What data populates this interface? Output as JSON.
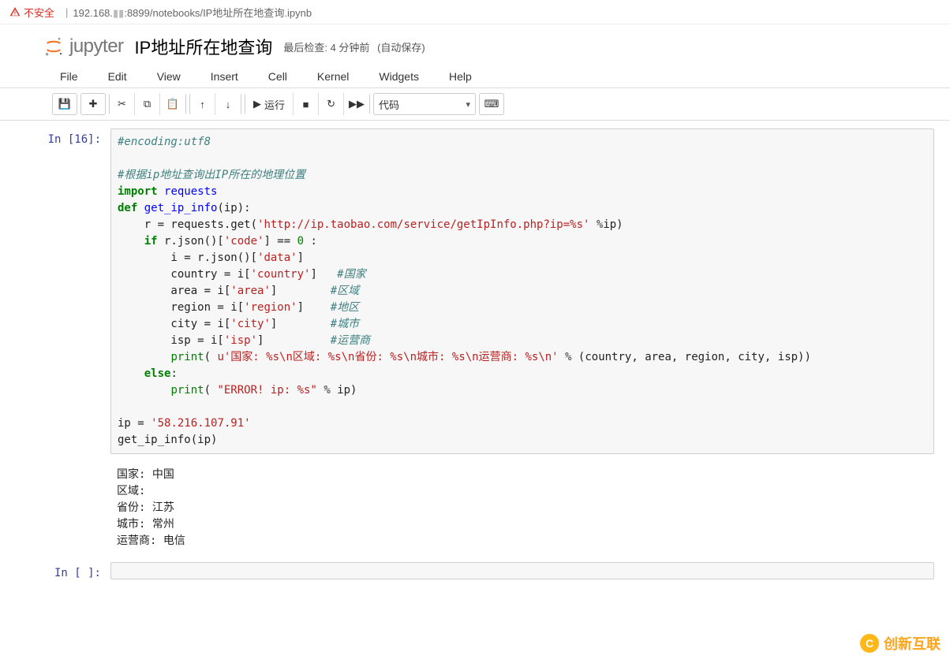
{
  "address_bar": {
    "security_label": "不安全",
    "url_prefix": "192.168.",
    "url_mid_masked": "▮▮",
    "url_suffix": ":8899/notebooks/IP地址所在地查询.ipynb"
  },
  "header": {
    "logo_text": "jupyter",
    "notebook_name": "IP地址所在地查询",
    "last_check_label": "最后检查:",
    "last_check_value": "4 分钟前",
    "autosave_label": "(自动保存)"
  },
  "menus": {
    "file": "File",
    "edit": "Edit",
    "view": "View",
    "insert": "Insert",
    "cell": "Cell",
    "kernel": "Kernel",
    "widgets": "Widgets",
    "help": "Help"
  },
  "toolbar": {
    "run_label": "运行",
    "cell_type": "代码"
  },
  "cells": [
    {
      "prompt": "In  [16]:",
      "code_tokens": [
        [
          [
            "#encoding:utf8",
            "c"
          ]
        ],
        [],
        [
          [
            "#根据ip地址查询出IP所在的地理位置",
            "c"
          ]
        ],
        [
          [
            "import",
            "kn"
          ],
          [
            " ",
            null
          ],
          [
            "requests",
            "nm"
          ]
        ],
        [
          [
            "def",
            "kn"
          ],
          [
            " ",
            null
          ],
          [
            "get_ip_info",
            "fn"
          ],
          [
            "(ip):",
            null
          ]
        ],
        [
          [
            "    r = requests.get(",
            null
          ],
          [
            "'http://ip.taobao.com/service/getIpInfo.php?ip=%s'",
            "st"
          ],
          [
            " ",
            null
          ],
          [
            "%",
            "op"
          ],
          [
            "ip)",
            null
          ]
        ],
        [
          [
            "    ",
            null
          ],
          [
            "if",
            "kw"
          ],
          [
            " r.json()[",
            null
          ],
          [
            "'code'",
            "st"
          ],
          [
            "] == ",
            null
          ],
          [
            "0",
            "nb"
          ],
          [
            " :",
            null
          ]
        ],
        [
          [
            "        i = r.json()[",
            null
          ],
          [
            "'data'",
            "st"
          ],
          [
            "]",
            null
          ]
        ],
        [
          [
            "        country = i[",
            null
          ],
          [
            "'country'",
            "st"
          ],
          [
            "]   ",
            null
          ],
          [
            "#国家",
            "c"
          ]
        ],
        [
          [
            "        area = i[",
            null
          ],
          [
            "'area'",
            "st"
          ],
          [
            "]        ",
            null
          ],
          [
            "#区域",
            "c"
          ]
        ],
        [
          [
            "        region = i[",
            null
          ],
          [
            "'region'",
            "st"
          ],
          [
            "]    ",
            null
          ],
          [
            "#地区",
            "c"
          ]
        ],
        [
          [
            "        city = i[",
            null
          ],
          [
            "'city'",
            "st"
          ],
          [
            "]        ",
            null
          ],
          [
            "#城市",
            "c"
          ]
        ],
        [
          [
            "        isp = i[",
            null
          ],
          [
            "'isp'",
            "st"
          ],
          [
            "]          ",
            null
          ],
          [
            "#运营商",
            "c"
          ]
        ],
        [
          [
            "        ",
            null
          ],
          [
            "print",
            "pr"
          ],
          [
            "( ",
            null
          ],
          [
            "u'国家: %s\\n区域: %s\\n省份: %s\\n城市: %s\\n运营商: %s\\n'",
            "st"
          ],
          [
            " ",
            null
          ],
          [
            "%",
            "op"
          ],
          [
            " (country, area, region, city, isp))",
            null
          ]
        ],
        [
          [
            "    ",
            null
          ],
          [
            "else",
            "kw"
          ],
          [
            ":",
            null
          ]
        ],
        [
          [
            "        ",
            null
          ],
          [
            "print",
            "pr"
          ],
          [
            "( ",
            null
          ],
          [
            "\"ERROR! ip: %s\"",
            "st"
          ],
          [
            " ",
            null
          ],
          [
            "%",
            "op"
          ],
          [
            " ip)",
            null
          ]
        ],
        [],
        [
          [
            "ip = ",
            null
          ],
          [
            "'58.216.107.91'",
            "st"
          ]
        ],
        [
          [
            "get_ip_info(ip)",
            null
          ]
        ]
      ],
      "output": "国家: 中国\n区域: \n省份: 江苏\n城市: 常州\n运营商: 电信"
    },
    {
      "prompt": "In  [ ]:",
      "code_tokens": [
        []
      ],
      "output": null
    }
  ],
  "watermark": {
    "text": "创新互联"
  }
}
